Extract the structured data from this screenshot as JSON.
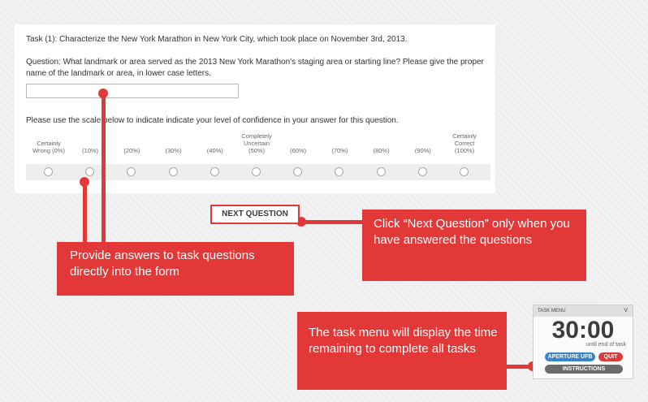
{
  "task": {
    "title": "Task (1): Characterize the New York Marathon in New York City, which took place on November 3rd, 2013.",
    "question": "Question: What landmark or area served as the 2013 New York Marathon's staging area or starting line? Please give the proper name of the landmark or area, in lower case letters.",
    "answer_value": "",
    "scale_instruction": "Please use the scale below to indicate indicate your level of confidence in your answer for this question."
  },
  "scale": {
    "labels": [
      {
        "top": "",
        "mid": "Certainly",
        "bottom": "Wrong (0%)"
      },
      {
        "top": "",
        "mid": "",
        "bottom": "(10%)"
      },
      {
        "top": "",
        "mid": "",
        "bottom": "(20%)"
      },
      {
        "top": "",
        "mid": "",
        "bottom": "(30%)"
      },
      {
        "top": "",
        "mid": "",
        "bottom": "(40%)"
      },
      {
        "top": "Completely",
        "mid": "Uncertain",
        "bottom": "(50%)"
      },
      {
        "top": "",
        "mid": "",
        "bottom": "(60%)"
      },
      {
        "top": "",
        "mid": "",
        "bottom": "(70%)"
      },
      {
        "top": "",
        "mid": "",
        "bottom": "(80%)"
      },
      {
        "top": "",
        "mid": "",
        "bottom": "(90%)"
      },
      {
        "top": "Certainly",
        "mid": "Correct",
        "bottom": "(100%)"
      }
    ]
  },
  "next_button": "NEXT QUESTION",
  "callouts": {
    "form": "Provide answers to task questions directly into the form",
    "next": "Click “Next Question” only when you have answered the questions",
    "menu": "The task menu will display the time remaining to complete all tasks"
  },
  "task_menu": {
    "header": "TASK MENU",
    "collapse": "V",
    "time": "30:00",
    "subtitle": "until end of task",
    "aperture": "APERTURE UFB",
    "quit": "QUIT",
    "instructions": "INSTRUCTIONS"
  },
  "colors": {
    "accent": "#e23838",
    "aperture": "#3a84c9",
    "instructions": "#6b6b6b"
  }
}
